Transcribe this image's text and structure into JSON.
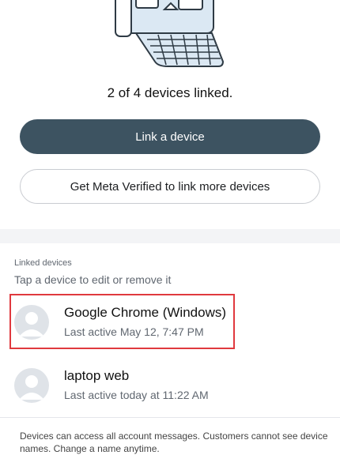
{
  "status": {
    "linked_text": "2 of 4 devices linked."
  },
  "buttons": {
    "link_device": "Link a device",
    "meta_verified": "Get Meta Verified to link more devices"
  },
  "linked_devices": {
    "label": "Linked devices",
    "hint": "Tap a device to edit or remove it",
    "items": [
      {
        "name": "Google Chrome (Windows)",
        "last_active": "Last active May 12, 7:47 PM",
        "highlighted": true
      },
      {
        "name": "laptop web",
        "last_active": "Last active today at 11:22 AM",
        "highlighted": false
      }
    ]
  },
  "footer": {
    "text": "Devices can access all account messages. Customers cannot see device names. Change a name anytime."
  },
  "colors": {
    "primary_button": "#3d5361",
    "highlight": "#e0393e",
    "illustration_fill": "#dbe8f3",
    "illustration_stroke": "#2f3b45"
  },
  "icons": {
    "hero": "laptop-chat-illustration",
    "avatar": "default-avatar-icon"
  }
}
